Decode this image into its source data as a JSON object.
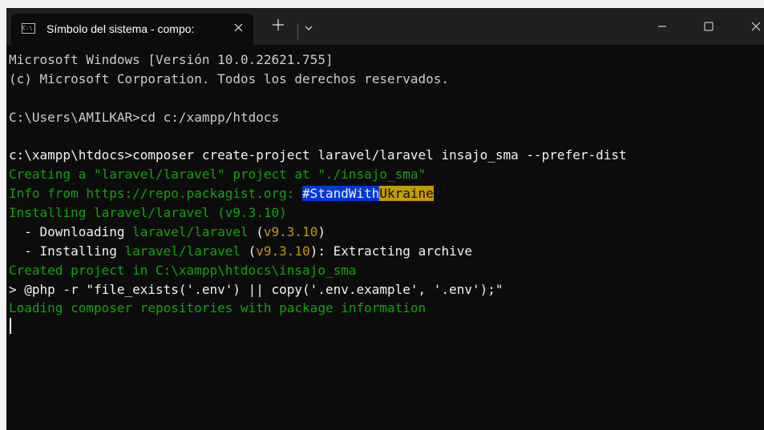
{
  "window": {
    "tab_title": "Símbolo del sistema - compo:",
    "tab_icon_text": "C:\\."
  },
  "icons": {
    "tab_icon": "cmd-icon",
    "close_tab": "close-icon",
    "new_tab": "plus-icon",
    "dropdown": "chevron-down-icon",
    "minimize": "minimize-icon",
    "maximize": "maximize-icon",
    "close_window": "close-icon"
  },
  "colors": {
    "console_bg": "#0c0c0c",
    "text": "#cccccc",
    "green": "#13a10e",
    "yellow": "#c19c00",
    "blue_highlight": "#0037da"
  },
  "console": {
    "l1": "Microsoft Windows [Versión 10.0.22621.755]",
    "l2": "(c) Microsoft Corporation. Todos los derechos reservados.",
    "l3": "C:\\Users\\AMILKAR>cd c:/xampp/htdocs",
    "l4": "c:\\xampp\\htdocs>composer create-project laravel/laravel insajo_sma --prefer-dist",
    "l5": "Creating a \"laravel/laravel\" project at \"./insajo_sma\"",
    "l6a": "Info from https://repo.packagist.org: ",
    "l6b": "#StandWith",
    "l6c": "Ukraine",
    "l7": "Installing laravel/laravel (v9.3.10)",
    "l8a": "  - Downloading ",
    "l8b": "laravel/laravel",
    "l8c": " (",
    "l8d": "v9.3.10",
    "l8e": ")",
    "l9a": "  - Installing ",
    "l9b": "laravel/laravel",
    "l9c": " (",
    "l9d": "v9.3.10",
    "l9e": "): Extracting archive",
    "l10": "Created project in C:\\xampp\\htdocs\\insajo_sma",
    "l11": "> @php -r \"file_exists('.env') || copy('.env.example', '.env');\"",
    "l12": "Loading composer repositories with package information"
  }
}
